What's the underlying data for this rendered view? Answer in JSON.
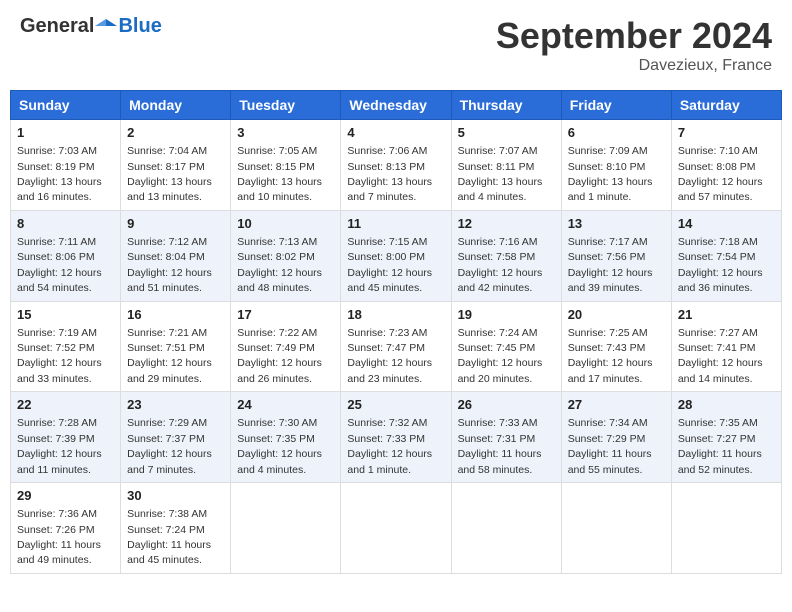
{
  "header": {
    "logo_general": "General",
    "logo_blue": "Blue",
    "month_title": "September 2024",
    "subtitle": "Davezieux, France"
  },
  "columns": [
    "Sunday",
    "Monday",
    "Tuesday",
    "Wednesday",
    "Thursday",
    "Friday",
    "Saturday"
  ],
  "weeks": [
    [
      {
        "day": "1",
        "sunrise": "Sunrise: 7:03 AM",
        "sunset": "Sunset: 8:19 PM",
        "daylight": "Daylight: 13 hours",
        "daylight2": "and 16 minutes."
      },
      {
        "day": "2",
        "sunrise": "Sunrise: 7:04 AM",
        "sunset": "Sunset: 8:17 PM",
        "daylight": "Daylight: 13 hours",
        "daylight2": "and 13 minutes."
      },
      {
        "day": "3",
        "sunrise": "Sunrise: 7:05 AM",
        "sunset": "Sunset: 8:15 PM",
        "daylight": "Daylight: 13 hours",
        "daylight2": "and 10 minutes."
      },
      {
        "day": "4",
        "sunrise": "Sunrise: 7:06 AM",
        "sunset": "Sunset: 8:13 PM",
        "daylight": "Daylight: 13 hours",
        "daylight2": "and 7 minutes."
      },
      {
        "day": "5",
        "sunrise": "Sunrise: 7:07 AM",
        "sunset": "Sunset: 8:11 PM",
        "daylight": "Daylight: 13 hours",
        "daylight2": "and 4 minutes."
      },
      {
        "day": "6",
        "sunrise": "Sunrise: 7:09 AM",
        "sunset": "Sunset: 8:10 PM",
        "daylight": "Daylight: 13 hours",
        "daylight2": "and 1 minute."
      },
      {
        "day": "7",
        "sunrise": "Sunrise: 7:10 AM",
        "sunset": "Sunset: 8:08 PM",
        "daylight": "Daylight: 12 hours",
        "daylight2": "and 57 minutes."
      }
    ],
    [
      {
        "day": "8",
        "sunrise": "Sunrise: 7:11 AM",
        "sunset": "Sunset: 8:06 PM",
        "daylight": "Daylight: 12 hours",
        "daylight2": "and 54 minutes."
      },
      {
        "day": "9",
        "sunrise": "Sunrise: 7:12 AM",
        "sunset": "Sunset: 8:04 PM",
        "daylight": "Daylight: 12 hours",
        "daylight2": "and 51 minutes."
      },
      {
        "day": "10",
        "sunrise": "Sunrise: 7:13 AM",
        "sunset": "Sunset: 8:02 PM",
        "daylight": "Daylight: 12 hours",
        "daylight2": "and 48 minutes."
      },
      {
        "day": "11",
        "sunrise": "Sunrise: 7:15 AM",
        "sunset": "Sunset: 8:00 PM",
        "daylight": "Daylight: 12 hours",
        "daylight2": "and 45 minutes."
      },
      {
        "day": "12",
        "sunrise": "Sunrise: 7:16 AM",
        "sunset": "Sunset: 7:58 PM",
        "daylight": "Daylight: 12 hours",
        "daylight2": "and 42 minutes."
      },
      {
        "day": "13",
        "sunrise": "Sunrise: 7:17 AM",
        "sunset": "Sunset: 7:56 PM",
        "daylight": "Daylight: 12 hours",
        "daylight2": "and 39 minutes."
      },
      {
        "day": "14",
        "sunrise": "Sunrise: 7:18 AM",
        "sunset": "Sunset: 7:54 PM",
        "daylight": "Daylight: 12 hours",
        "daylight2": "and 36 minutes."
      }
    ],
    [
      {
        "day": "15",
        "sunrise": "Sunrise: 7:19 AM",
        "sunset": "Sunset: 7:52 PM",
        "daylight": "Daylight: 12 hours",
        "daylight2": "and 33 minutes."
      },
      {
        "day": "16",
        "sunrise": "Sunrise: 7:21 AM",
        "sunset": "Sunset: 7:51 PM",
        "daylight": "Daylight: 12 hours",
        "daylight2": "and 29 minutes."
      },
      {
        "day": "17",
        "sunrise": "Sunrise: 7:22 AM",
        "sunset": "Sunset: 7:49 PM",
        "daylight": "Daylight: 12 hours",
        "daylight2": "and 26 minutes."
      },
      {
        "day": "18",
        "sunrise": "Sunrise: 7:23 AM",
        "sunset": "Sunset: 7:47 PM",
        "daylight": "Daylight: 12 hours",
        "daylight2": "and 23 minutes."
      },
      {
        "day": "19",
        "sunrise": "Sunrise: 7:24 AM",
        "sunset": "Sunset: 7:45 PM",
        "daylight": "Daylight: 12 hours",
        "daylight2": "and 20 minutes."
      },
      {
        "day": "20",
        "sunrise": "Sunrise: 7:25 AM",
        "sunset": "Sunset: 7:43 PM",
        "daylight": "Daylight: 12 hours",
        "daylight2": "and 17 minutes."
      },
      {
        "day": "21",
        "sunrise": "Sunrise: 7:27 AM",
        "sunset": "Sunset: 7:41 PM",
        "daylight": "Daylight: 12 hours",
        "daylight2": "and 14 minutes."
      }
    ],
    [
      {
        "day": "22",
        "sunrise": "Sunrise: 7:28 AM",
        "sunset": "Sunset: 7:39 PM",
        "daylight": "Daylight: 12 hours",
        "daylight2": "and 11 minutes."
      },
      {
        "day": "23",
        "sunrise": "Sunrise: 7:29 AM",
        "sunset": "Sunset: 7:37 PM",
        "daylight": "Daylight: 12 hours",
        "daylight2": "and 7 minutes."
      },
      {
        "day": "24",
        "sunrise": "Sunrise: 7:30 AM",
        "sunset": "Sunset: 7:35 PM",
        "daylight": "Daylight: 12 hours",
        "daylight2": "and 4 minutes."
      },
      {
        "day": "25",
        "sunrise": "Sunrise: 7:32 AM",
        "sunset": "Sunset: 7:33 PM",
        "daylight": "Daylight: 12 hours",
        "daylight2": "and 1 minute."
      },
      {
        "day": "26",
        "sunrise": "Sunrise: 7:33 AM",
        "sunset": "Sunset: 7:31 PM",
        "daylight": "Daylight: 11 hours",
        "daylight2": "and 58 minutes."
      },
      {
        "day": "27",
        "sunrise": "Sunrise: 7:34 AM",
        "sunset": "Sunset: 7:29 PM",
        "daylight": "Daylight: 11 hours",
        "daylight2": "and 55 minutes."
      },
      {
        "day": "28",
        "sunrise": "Sunrise: 7:35 AM",
        "sunset": "Sunset: 7:27 PM",
        "daylight": "Daylight: 11 hours",
        "daylight2": "and 52 minutes."
      }
    ],
    [
      {
        "day": "29",
        "sunrise": "Sunrise: 7:36 AM",
        "sunset": "Sunset: 7:26 PM",
        "daylight": "Daylight: 11 hours",
        "daylight2": "and 49 minutes."
      },
      {
        "day": "30",
        "sunrise": "Sunrise: 7:38 AM",
        "sunset": "Sunset: 7:24 PM",
        "daylight": "Daylight: 11 hours",
        "daylight2": "and 45 minutes."
      },
      null,
      null,
      null,
      null,
      null
    ]
  ]
}
